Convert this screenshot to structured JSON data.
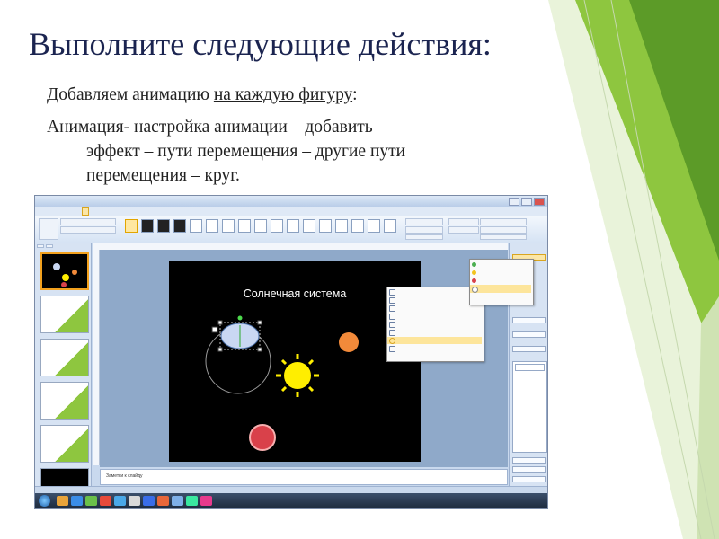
{
  "heading": "Выполните следующие действия:",
  "paragraph1": {
    "before": "Добавляем анимацию ",
    "underlined": "на каждую фигуру",
    "after": ":"
  },
  "paragraph2": {
    "line1": "Анимация- настройка анимации – добавить",
    "line2": "эффект – пути перемещения – другие пути",
    "line3": "перемещения – круг."
  },
  "screenshot": {
    "slide_caption": "Солнечная система",
    "notes_placeholder": "Заметки к слайду",
    "colors": {
      "slide_bg": "#000000",
      "sun": "#ffee00",
      "planet_orange": "#f28a3a",
      "planet_red": "#d9414a",
      "planet_blue": "#c9d7f2",
      "highlight": "#fde59b"
    }
  },
  "colors": {
    "heading": "#1b2450",
    "accent_green": "#8ec63f",
    "dark_green": "#4e8a1e"
  }
}
